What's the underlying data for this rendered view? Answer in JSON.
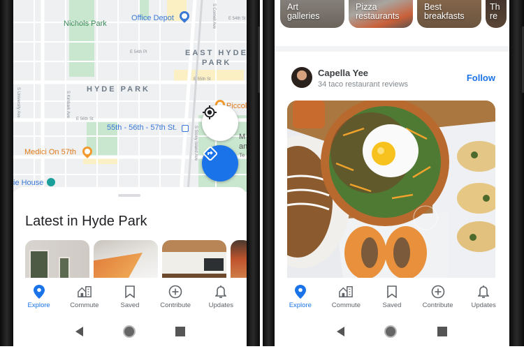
{
  "left_phone": {
    "map": {
      "labels": {
        "nichols_park": "Nichols Park",
        "office_depot": "Office Depot",
        "east_hyde_park_1": "EAST HYDE",
        "east_hyde_park_2": "PARK",
        "hyde_park": "HYDE PARK",
        "e_54th_pl": "E 54th Pl",
        "e_54th_st": "E 54th St",
        "e_55th_st": "E 55th St",
        "e_56th_st": "E 56th St",
        "s_cornell_ave": "S Cornell Ave",
        "s_university_ave": "S University Ave",
        "s_kimbark_ave": "S Kimbark Ave",
        "s_stony_island_ave": "S Stony Island Ave",
        "transit_station": "55th - 56th - 57th St.",
        "medici": "Medici On 57th",
        "piccolo": "Piccolo",
        "museum_partial_1": "M",
        "museum_partial_2": "an",
        "museum_partial_3": "Te",
        "house_partial": "ie House"
      },
      "colors": {
        "park_green": "#c9e6cf",
        "poi_blue": "#3a78d6",
        "poi_orange": "#f29a2e",
        "fab_blue": "#1a73e8"
      }
    },
    "sheet": {
      "title": "Latest in Hyde Park"
    }
  },
  "right_phone": {
    "categories": [
      {
        "line1": "Art",
        "line2": "galleries"
      },
      {
        "line1": "Pizza",
        "line2": "restaurants"
      },
      {
        "line1": "Best",
        "line2": "breakfasts"
      },
      {
        "line1": "Th",
        "line2": "re"
      }
    ],
    "reviewer": {
      "name": "Capella Yee",
      "subtitle": "34 taco restaurant reviews",
      "follow_label": "Follow"
    }
  },
  "bottom_nav": {
    "items": [
      {
        "label": "Explore",
        "icon": "location-pin-icon",
        "active": true
      },
      {
        "label": "Commute",
        "icon": "commute-icon",
        "active": false
      },
      {
        "label": "Saved",
        "icon": "bookmark-icon",
        "active": false
      },
      {
        "label": "Contribute",
        "icon": "add-circle-icon",
        "active": false
      },
      {
        "label": "Updates",
        "icon": "bell-icon",
        "active": false
      }
    ],
    "active_color": "#1a73e8",
    "inactive_color": "#5f6368"
  }
}
